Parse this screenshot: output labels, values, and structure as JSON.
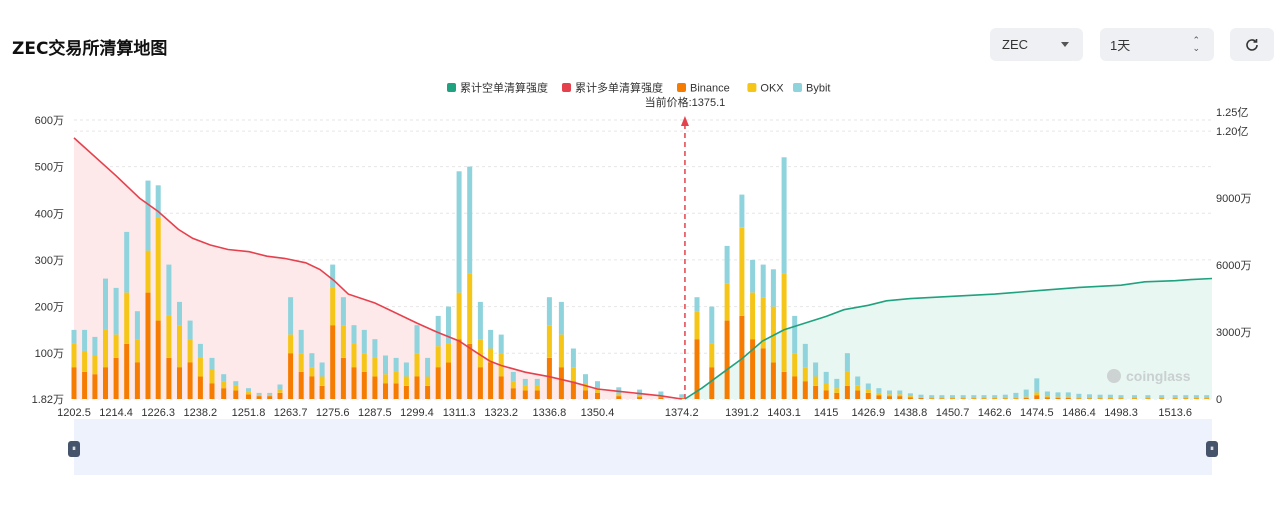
{
  "header": {
    "title": "ZEC交易所清算地图",
    "coin_select": "ZEC",
    "timeframe_select": "1天",
    "refresh_icon": "refresh-icon"
  },
  "watermark": "coinglass",
  "colors": {
    "short_cum": "#1fa27f",
    "long_cum": "#e5414d",
    "binance": "#f57c00",
    "okx": "#f5c518",
    "bybit": "#8fd3dc",
    "short_fill": "#e8f7f1",
    "long_fill": "#fde8ea"
  },
  "chart_data": {
    "type": "bar",
    "title": "",
    "current_price_label": "当前价格:1375.1",
    "current_price": 1375.1,
    "legend": [
      "累计空单清算强度",
      "累计多单清算强度",
      "Binance",
      "OKX",
      "Bybit"
    ],
    "legend_position": "top-center",
    "x_range": [
      1202.5,
      1524
    ],
    "x_tick_labels": [
      "1202.5",
      "1214.4",
      "1226.3",
      "1238.2",
      "1251.8",
      "1263.7",
      "1275.6",
      "1287.5",
      "1299.4",
      "1311.3",
      "1323.2",
      "1336.8",
      "1350.4",
      "1374.2",
      "1391.2",
      "1403.1",
      "1415",
      "1426.9",
      "1438.8",
      "1450.7",
      "1462.6",
      "1474.5",
      "1486.4",
      "1498.3",
      "1513.6"
    ],
    "y_left_ticks": [
      "1.82万",
      "100万",
      "200万",
      "300万",
      "400万",
      "500万",
      "600万"
    ],
    "y_left_range": [
      18200,
      6000000
    ],
    "y_right_ticks": [
      "0",
      "3000万",
      "6000万",
      "9000万",
      "1.20亿",
      "1.25亿"
    ],
    "y_right_range": [
      0,
      125000000
    ],
    "grid": true,
    "bars": {
      "x": [
        1202.5,
        1205.5,
        1208.4,
        1211.4,
        1214.4,
        1217.4,
        1220.4,
        1223.4,
        1226.3,
        1229.3,
        1232.3,
        1235.3,
        1238.2,
        1241.5,
        1244.8,
        1248.2,
        1251.8,
        1254.8,
        1257.8,
        1260.7,
        1263.7,
        1266.7,
        1269.7,
        1272.6,
        1275.6,
        1278.6,
        1281.6,
        1284.5,
        1287.5,
        1290.5,
        1293.5,
        1296.4,
        1299.4,
        1302.4,
        1305.4,
        1308.3,
        1311.3,
        1314.3,
        1317.3,
        1320.2,
        1323.2,
        1326.6,
        1330.0,
        1333.4,
        1336.8,
        1340.2,
        1343.6,
        1347.0,
        1350.4,
        1356.4,
        1362.3,
        1368.3,
        1374.2,
        1378.5,
        1382.7,
        1387.0,
        1391.2,
        1394.2,
        1397.2,
        1400.1,
        1403.1,
        1406.1,
        1409.1,
        1412.0,
        1415.0,
        1418.0,
        1421.0,
        1423.9,
        1426.9,
        1429.9,
        1432.9,
        1435.8,
        1438.8,
        1441.8,
        1444.8,
        1447.7,
        1450.7,
        1453.7,
        1456.7,
        1459.6,
        1462.6,
        1465.6,
        1468.6,
        1471.5,
        1474.5,
        1477.5,
        1480.5,
        1483.4,
        1486.4,
        1489.4,
        1492.4,
        1495.3,
        1498.3,
        1502.1,
        1505.9,
        1509.8,
        1513.6,
        1516.6,
        1519.6,
        1522.5
      ],
      "binance": [
        700000,
        600000,
        550000,
        700000,
        900000,
        1200000,
        800000,
        2300000,
        1700000,
        900000,
        700000,
        800000,
        500000,
        350000,
        250000,
        200000,
        120000,
        80000,
        80000,
        150000,
        1000000,
        600000,
        500000,
        300000,
        1600000,
        900000,
        700000,
        600000,
        500000,
        350000,
        350000,
        300000,
        500000,
        300000,
        700000,
        800000,
        1300000,
        1200000,
        700000,
        800000,
        500000,
        250000,
        200000,
        200000,
        900000,
        700000,
        400000,
        200000,
        150000,
        80000,
        60000,
        50000,
        40000,
        1300000,
        700000,
        1700000,
        1800000,
        1300000,
        1100000,
        800000,
        600000,
        500000,
        400000,
        300000,
        200000,
        150000,
        300000,
        200000,
        150000,
        100000,
        80000,
        80000,
        50000,
        40000,
        30000,
        30000,
        30000,
        30000,
        30000,
        30000,
        30000,
        30000,
        30000,
        40000,
        100000,
        50000,
        40000,
        40000,
        30000,
        30000,
        30000,
        30000,
        30000,
        30000,
        30000,
        30000,
        30000,
        30000,
        30000,
        30000
      ],
      "okx": [
        500000,
        450000,
        400000,
        800000,
        500000,
        1100000,
        500000,
        900000,
        2200000,
        900000,
        900000,
        500000,
        400000,
        300000,
        150000,
        100000,
        50000,
        30000,
        30000,
        80000,
        400000,
        400000,
        200000,
        200000,
        800000,
        700000,
        500000,
        400000,
        400000,
        200000,
        250000,
        200000,
        500000,
        200000,
        450000,
        400000,
        1000000,
        1500000,
        600000,
        300000,
        500000,
        150000,
        100000,
        100000,
        700000,
        700000,
        300000,
        150000,
        100000,
        40000,
        30000,
        30000,
        20000,
        600000,
        500000,
        800000,
        1900000,
        1000000,
        1100000,
        1200000,
        2100000,
        500000,
        300000,
        200000,
        150000,
        100000,
        300000,
        100000,
        80000,
        50000,
        40000,
        40000,
        30000,
        20000,
        20000,
        20000,
        20000,
        20000,
        20000,
        20000,
        20000,
        20000,
        20000,
        30000,
        60000,
        30000,
        30000,
        30000,
        20000,
        20000,
        20000,
        20000,
        20000,
        20000,
        20000,
        20000,
        20000,
        20000,
        20000,
        20000
      ],
      "bybit": [
        300000,
        450000,
        400000,
        1100000,
        1000000,
        1300000,
        600000,
        1500000,
        700000,
        1100000,
        500000,
        400000,
        300000,
        250000,
        150000,
        100000,
        80000,
        40000,
        40000,
        100000,
        800000,
        500000,
        300000,
        300000,
        500000,
        600000,
        400000,
        500000,
        400000,
        400000,
        300000,
        300000,
        600000,
        400000,
        650000,
        800000,
        2600000,
        2300000,
        800000,
        400000,
        400000,
        200000,
        150000,
        150000,
        600000,
        700000,
        400000,
        200000,
        150000,
        150000,
        130000,
        100000,
        60000,
        300000,
        800000,
        800000,
        700000,
        700000,
        700000,
        800000,
        2500000,
        800000,
        500000,
        300000,
        250000,
        200000,
        400000,
        200000,
        120000,
        100000,
        80000,
        80000,
        60000,
        50000,
        50000,
        50000,
        50000,
        50000,
        50000,
        50000,
        50000,
        60000,
        100000,
        150000,
        300000,
        100000,
        90000,
        90000,
        80000,
        70000,
        60000,
        60000,
        50000,
        50000,
        50000,
        50000,
        50000,
        50000,
        50000,
        50000
      ]
    },
    "cumulative_long": {
      "x": [
        1202.5,
        1214.4,
        1221.0,
        1226.3,
        1232.0,
        1236.0,
        1241.0,
        1246.0,
        1252.0,
        1257.0,
        1262.0,
        1268.0,
        1272.0,
        1276.0,
        1280.0,
        1287.5,
        1299.4,
        1305.0,
        1311.3,
        1316.0,
        1320.0,
        1323.2,
        1330.0,
        1336.8,
        1343.6,
        1350.4,
        1356.0,
        1362.0,
        1368.0,
        1374.2
      ],
      "values": [
        117000000,
        100000000,
        90000000,
        84000000,
        76000000,
        72000000,
        69000000,
        67000000,
        66000000,
        64000000,
        63000000,
        61000000,
        58000000,
        53000000,
        47000000,
        43000000,
        34000000,
        30000000,
        26000000,
        21000000,
        17000000,
        15000000,
        12000000,
        10000000,
        7500000,
        4500000,
        3500000,
        2500000,
        1500000,
        0
      ]
    },
    "cumulative_short": {
      "x": [
        1375.1,
        1380.0,
        1386.0,
        1391.2,
        1397.0,
        1403.1,
        1409.0,
        1415.0,
        1420.0,
        1426.9,
        1432.0,
        1438.8,
        1450.7,
        1462.6,
        1474.5,
        1486.4,
        1498.3,
        1505.0,
        1513.6,
        1518.0,
        1524.0
      ],
      "values": [
        0,
        5000000,
        12000000,
        18000000,
        26000000,
        31000000,
        34000000,
        37000000,
        40000000,
        42000000,
        44000000,
        45000000,
        46000000,
        47000000,
        48500000,
        50000000,
        51000000,
        52500000,
        53000000,
        53500000,
        54000000
      ]
    }
  }
}
